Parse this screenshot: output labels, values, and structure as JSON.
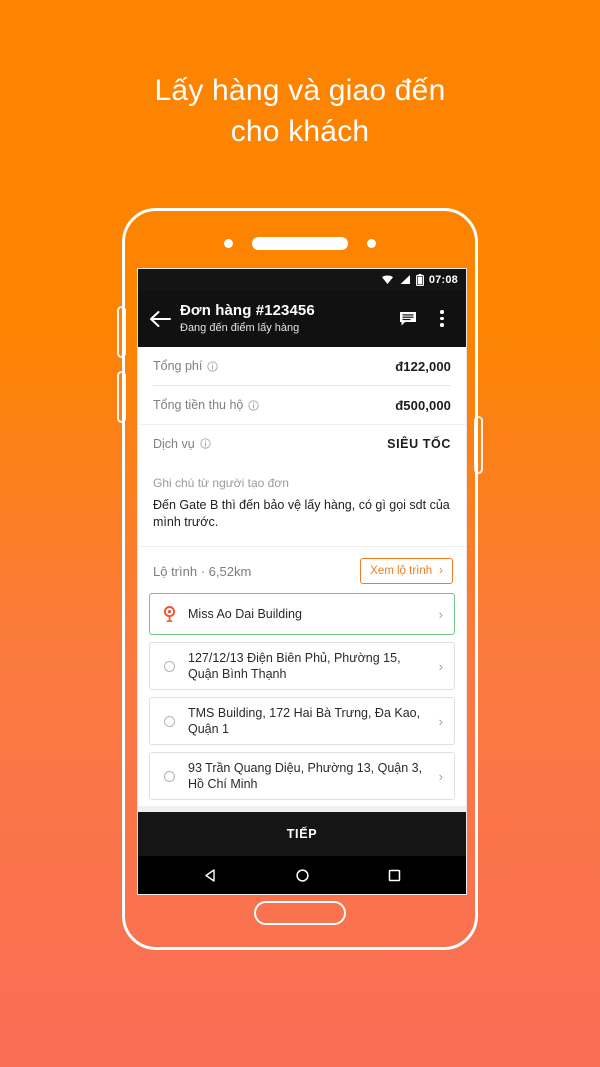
{
  "headline": {
    "line1": "Lấy hàng và giao đến",
    "line2": "cho khách"
  },
  "colors": {
    "bg_top": "#FC8400",
    "bg_bottom": "#FA6D57",
    "accent_orange": "#F47B20",
    "active_green": "#77C487"
  },
  "statusbar": {
    "time": "07:08",
    "icons": [
      "wifi-icon",
      "signal-icon",
      "battery-icon"
    ]
  },
  "appbar": {
    "back": "back-arrow-icon",
    "title": "Đơn hàng #123456",
    "subtitle": "Đang đến điểm lấy hàng",
    "chat": "chat-icon",
    "menu": "overflow-menu-icon"
  },
  "summary": {
    "rows": [
      {
        "label": "Tổng phí",
        "info": "info-icon",
        "value": "đ122,000"
      },
      {
        "label": "Tổng tiền thu hộ",
        "info": "info-icon",
        "value": "đ500,000"
      }
    ],
    "service": {
      "label": "Dịch vụ",
      "info": "info-icon",
      "value": "SIÊU TỐC"
    }
  },
  "note": {
    "label": "Ghi chú từ người tạo đơn",
    "text": "Đến Gate B thì đến bảo vệ lấy hàng, có gì gọi sdt của mình trước."
  },
  "route": {
    "label": "Lộ trình · 6,52km",
    "button_label": "Xem lộ trình",
    "button_chevron": "›",
    "items": [
      {
        "text": "Miss Ao Dai Building",
        "marker": "pin-icon",
        "active": true,
        "chevron": "›"
      },
      {
        "text": "127/12/13 Điện Biên Phủ, Phường 15, Quận Bình Thạnh",
        "marker": "circle-icon",
        "active": false,
        "chevron": "›"
      },
      {
        "text": "TMS Building, 172 Hai Bà Trưng, Đa Kao, Quận 1",
        "marker": "circle-icon",
        "active": false,
        "chevron": "›"
      },
      {
        "text": "93 Trần Quang Diệu, Phường 13, Quận 3, Hồ Chí Minh",
        "marker": "circle-icon",
        "active": false,
        "chevron": "›"
      }
    ]
  },
  "cta": {
    "label": "TIẾP"
  },
  "navbar": {
    "back": "android-back-icon",
    "home": "android-home-icon",
    "recents": "android-recents-icon"
  }
}
